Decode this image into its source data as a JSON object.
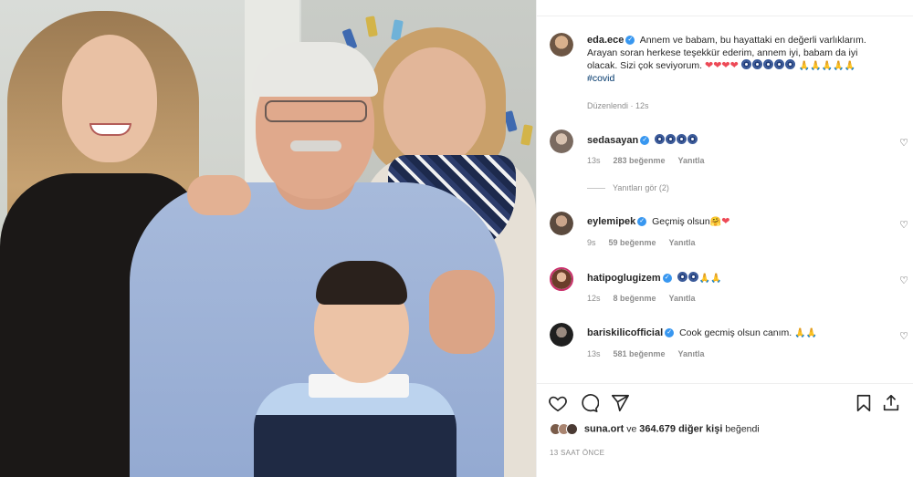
{
  "post": {
    "author": "eda.ece",
    "caption_lines": [
      "Annem ve babam, bu hayattaki en değerli varlıklarım.",
      "Arayan soran herkese teşekkür ederim, annem iyi, babam da iyi",
      "olacak. Sizi çok seviyorum."
    ],
    "hashtag": "#covid",
    "edited_label": "Düzenlendi",
    "edited_time": "12s"
  },
  "comments": [
    {
      "user": "sedasayan",
      "text": "",
      "emoji": [
        "circle",
        "circle",
        "circle",
        "circle"
      ],
      "time": "13s",
      "likes": "283 beğenme",
      "reply": "Yanıtla",
      "avatar_color": "#7a6a60"
    },
    {
      "user": "eylemipek",
      "text": "Geçmiş olsun",
      "emoji": [
        "hug",
        "heart"
      ],
      "time": "9s",
      "likes": "59 beğenme",
      "reply": "Yanıtla",
      "avatar_color": "#5b4a3e"
    },
    {
      "user": "hatipoglugizem",
      "text": "",
      "emoji": [
        "circle",
        "circle",
        "pray",
        "pray"
      ],
      "time": "12s",
      "likes": "8 beğenme",
      "reply": "Yanıtla",
      "avatar_color": "#c9306b"
    },
    {
      "user": "bariskilicofficial",
      "text": "Cook gecmiş olsun canım.",
      "emoji": [
        "pray",
        "pray"
      ],
      "time": "13s",
      "likes": "581 beğenme",
      "reply": "Yanıtla",
      "avatar_color": "#3a3a3a"
    }
  ],
  "replies_label": "Yanıtları gör (2)",
  "likes_summary": {
    "first_user": "suna.ort",
    "joiner": "ve",
    "count_text": "364.679 diğer kişi",
    "suffix": "beğendi"
  },
  "timestamp": "13 SAAT ÖNCE",
  "icons": [
    "heart-icon",
    "comment-icon",
    "share-icon",
    "bookmark-icon",
    "upload-icon"
  ],
  "colors": {
    "verified": "#3897f0",
    "hashtag": "#00376b",
    "meta": "#8e8e8e",
    "heart": "#ed4956"
  }
}
